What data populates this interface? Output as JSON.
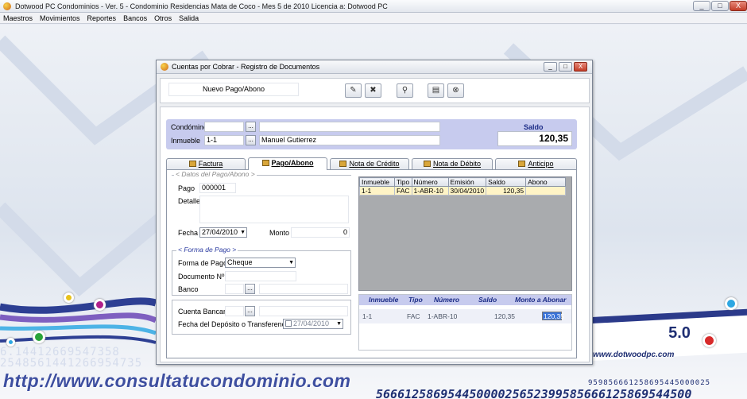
{
  "app": {
    "title": "Dotwood PC Condominios - Ver. 5  - Condominio Residencias Mata de Coco  - Mes 5 de 2010    Licencia a: Dotwood PC",
    "window_controls": {
      "minimize": "_",
      "maximize": "□",
      "close": "X"
    }
  },
  "menu": [
    "Maestros",
    "Movimientos",
    "Reportes",
    "Bancos",
    "Otros",
    "Salida"
  ],
  "background": {
    "url": "http://www.consultatucondominio.com",
    "version": "5.0",
    "website": "www.dotwoodpc.com",
    "numbers": [
      "6.14412669547358",
      "2548561441266954735",
      "56661258695445000025652399585666125869544500",
      "959856661258695445000025"
    ]
  },
  "dialog": {
    "title": "Cuentas por Cobrar - Registro de Documentos",
    "controls": {
      "minimize": "_",
      "maximize": "□",
      "close": "X"
    },
    "mode_label": "Nuevo Pago/Abono",
    "toolbar_icons": [
      "edit-icon",
      "delete-icon",
      "search-icon",
      "save-icon",
      "close-circle-icon"
    ],
    "header": {
      "condominio_label": "Condómino",
      "condominio_value": "",
      "condominio_name": "",
      "inmueble_label": "Inmueble",
      "inmueble_value": "1-1",
      "inmueble_name": "Manuel Gutierrez",
      "ellipsis": "...",
      "saldo_label": "Saldo",
      "saldo_value": "120,35"
    },
    "tabs": [
      {
        "label": "Factura",
        "active": false
      },
      {
        "label": "Pago/Abono",
        "active": true
      },
      {
        "label": "Nota de Crédito",
        "active": false
      },
      {
        "label": "Nota de Débito",
        "active": false
      },
      {
        "label": "Anticipo",
        "active": false
      }
    ],
    "datos": {
      "group_title": "< Datos del Pago/Abono >",
      "pago_label": "Pago",
      "pago_value": "000001",
      "detalle_label": "Detalle",
      "detalle_value": "",
      "fecha_label": "Fecha",
      "fecha_value": "27/04/2010",
      "monto_label": "Monto",
      "monto_value": "0"
    },
    "forma": {
      "group_title": "< Forma de Pago >",
      "forma_label": "Forma de Pago",
      "forma_value": "Cheque",
      "documento_label": "Documento Nº",
      "documento_value": "",
      "banco_label": "Banco",
      "banco_value": "",
      "cuenta_label": "Cuenta Bancaria",
      "cuenta_value": "",
      "deposito_label": "Fecha del Depósito o Transferencia",
      "deposito_value": "27/04/2010"
    },
    "grid": {
      "columns": [
        "Inmueble",
        "Tipo",
        "Número",
        "Emisión",
        "Saldo",
        "Abono"
      ],
      "rows": [
        {
          "inmueble": "1-1",
          "tipo": "FAC",
          "numero": "1-ABR-10",
          "emision": "30/04/2010",
          "saldo": "120,35",
          "abono": ""
        }
      ]
    },
    "apply": {
      "columns": [
        "Inmueble",
        "Tipo",
        "Número",
        "Saldo",
        "Monto a Abonar"
      ],
      "row": {
        "inmueble": "1-1",
        "tipo": "FAC",
        "numero": "1-ABR-10",
        "saldo": "120,35",
        "monto": "120,35"
      }
    }
  }
}
